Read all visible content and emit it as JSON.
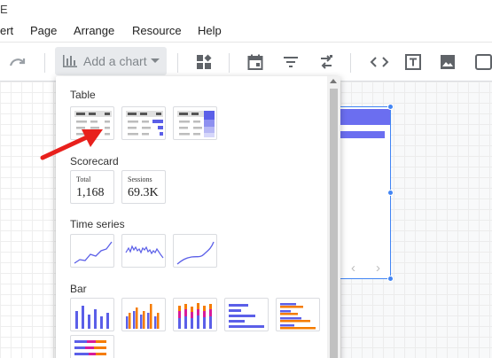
{
  "menu": {
    "partial_mark": "E",
    "items": [
      "ert",
      "Page",
      "Arrange",
      "Resource",
      "Help"
    ]
  },
  "toolbar": {
    "add_chart_label": "Add a chart"
  },
  "canvas": {
    "pager_prev": "‹",
    "pager_next": "›"
  },
  "chart_menu": {
    "sections": {
      "table": "Table",
      "scorecard": "Scorecard",
      "time_series": "Time series",
      "bar": "Bar"
    },
    "scorecards": [
      {
        "label": "Total",
        "value": "1,168"
      },
      {
        "label": "Sessions",
        "value": "69.3K"
      }
    ]
  },
  "colors": {
    "accent": "#5b5fe8",
    "accent_light": "#6b6ef0",
    "orange": "#f57c00",
    "magenta": "#d81b9a",
    "arrow": "#e8201c",
    "selection": "#4285f4"
  }
}
